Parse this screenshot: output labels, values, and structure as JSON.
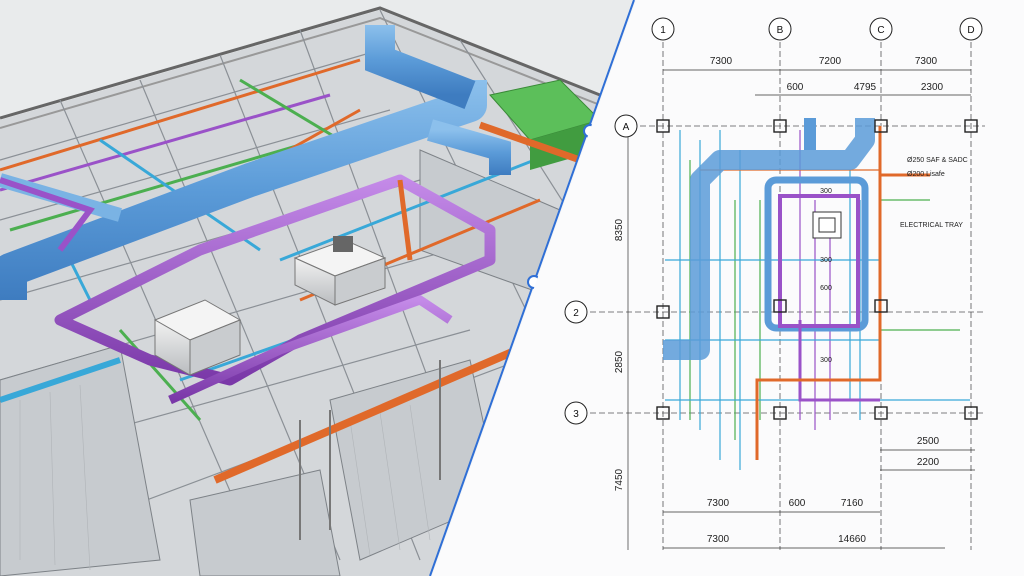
{
  "colors": {
    "duct_blue": "#5b9bd8",
    "pipe_purple": "#9a52c8",
    "pipe_orange": "#e0692a",
    "pipe_green": "#4caf50",
    "pipe_cyan": "#38a8d8",
    "divider_blue": "#2f6fd6"
  },
  "plan": {
    "column_labels": [
      "1",
      "B",
      "C",
      "D"
    ],
    "row_labels": [
      "A",
      "2",
      "3"
    ],
    "top_dims_row1": [
      "7300",
      "7200",
      "7300"
    ],
    "top_dims_row2": [
      "600",
      "4795",
      "2300"
    ],
    "left_dims": [
      "8350",
      "2850",
      "7450"
    ],
    "bottom_dims_row1": [
      "7300",
      "600",
      "7160"
    ],
    "bottom_dims_row2": [
      "7300",
      "14660"
    ],
    "right_dims": [
      "2500",
      "2200"
    ],
    "inner_dims": [
      "300",
      "300",
      "600",
      "300"
    ],
    "notes": [
      "Ø250 SAF & SADC",
      "Ø200 Lisafe",
      "ELECTRICAL TRAY"
    ]
  }
}
